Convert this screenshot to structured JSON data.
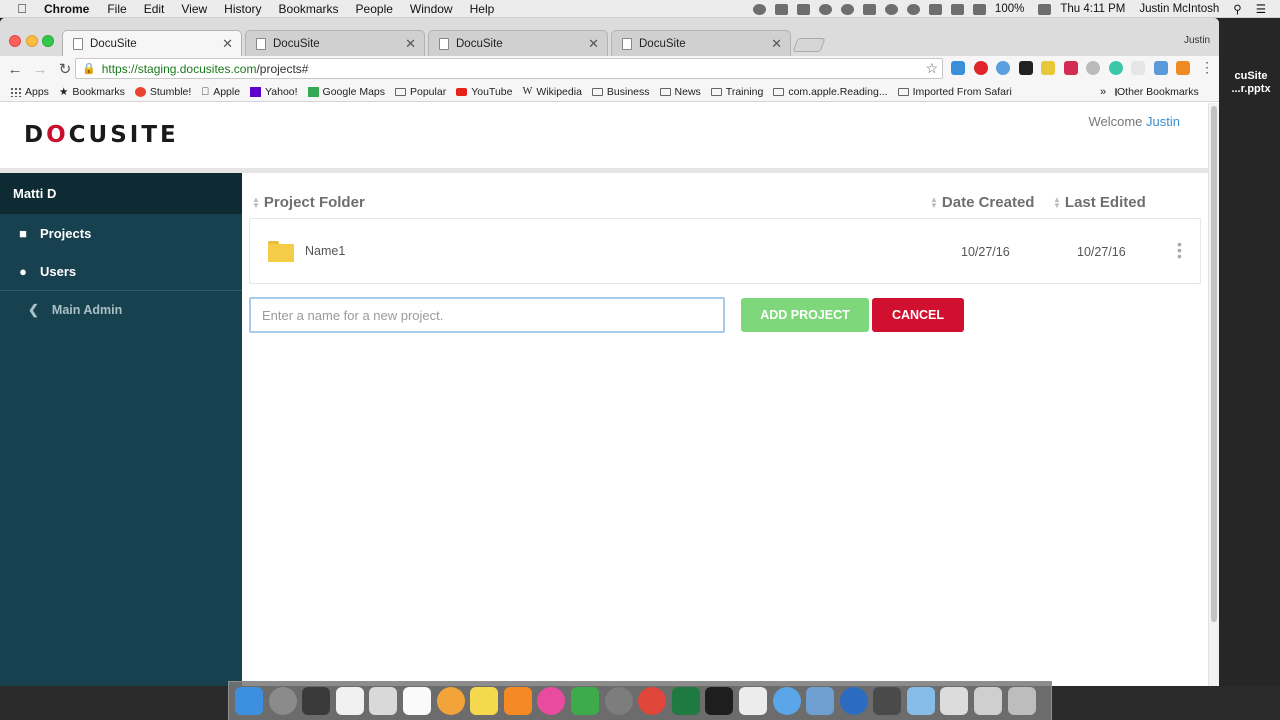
{
  "menubar": {
    "app_name": "Chrome",
    "items": [
      "File",
      "Edit",
      "View",
      "History",
      "Bookmarks",
      "People",
      "Window",
      "Help"
    ],
    "battery": "100%",
    "clock": "Thu 4:11 PM",
    "user": "Justin McIntosh"
  },
  "desktop": {
    "file_label": "cuSite ...r.pptx"
  },
  "browser": {
    "tabs": [
      {
        "title": "DocuSite",
        "active": true
      },
      {
        "title": "DocuSite",
        "active": false
      },
      {
        "title": "DocuSite",
        "active": false
      },
      {
        "title": "DocuSite",
        "active": false
      }
    ],
    "profile_name": "Justin",
    "url_base": "https://staging.docusites.com",
    "url_path": "/projects#",
    "bookmarks": [
      {
        "label": "Apps",
        "icon": "apps-grid-icon"
      },
      {
        "label": "Bookmarks",
        "icon": "star-icon"
      },
      {
        "label": "Stumble!",
        "icon": "stumble-icon"
      },
      {
        "label": "Apple",
        "icon": "apple-icon"
      },
      {
        "label": "Yahoo!",
        "icon": "yahoo-icon"
      },
      {
        "label": "Google Maps",
        "icon": "maps-icon"
      },
      {
        "label": "Popular",
        "icon": "folder-icon"
      },
      {
        "label": "YouTube",
        "icon": "youtube-icon"
      },
      {
        "label": "Wikipedia",
        "icon": "wikipedia-icon"
      },
      {
        "label": "Business",
        "icon": "folder-icon"
      },
      {
        "label": "News",
        "icon": "folder-icon"
      },
      {
        "label": "Training",
        "icon": "folder-icon"
      },
      {
        "label": "com.apple.Reading...",
        "icon": "folder-icon"
      },
      {
        "label": "Imported From Safari",
        "icon": "folder-icon"
      }
    ],
    "other_bookmarks": "Other Bookmarks"
  },
  "header": {
    "logo_left": "D",
    "logo_pin": "O",
    "logo_right": "CUSITE",
    "welcome_prefix": "Welcome",
    "welcome_name": "Justin"
  },
  "sidebar": {
    "user_name": "Matti D",
    "items": [
      {
        "label": "Projects",
        "icon": "folder-icon"
      },
      {
        "label": "Users",
        "icon": "user-icon"
      }
    ],
    "sub_item": "Main Admin"
  },
  "table": {
    "headers": {
      "folder": "Project Folder",
      "created": "Date Created",
      "edited": "Last Edited"
    },
    "rows": [
      {
        "name": "Name1",
        "created": "10/27/16",
        "edited": "10/27/16"
      }
    ]
  },
  "new_project": {
    "placeholder": "Enter a name for a new project.",
    "add_label": "ADD PROJECT",
    "cancel_label": "CANCEL"
  },
  "colors": {
    "sidebar_bg": "#17414f",
    "sidebar_user_bg": "#0e2a33",
    "add_button": "#7fd77b",
    "cancel_button": "#d0102e",
    "brand_red": "#c8102e",
    "link_blue": "#3a8fd0"
  }
}
